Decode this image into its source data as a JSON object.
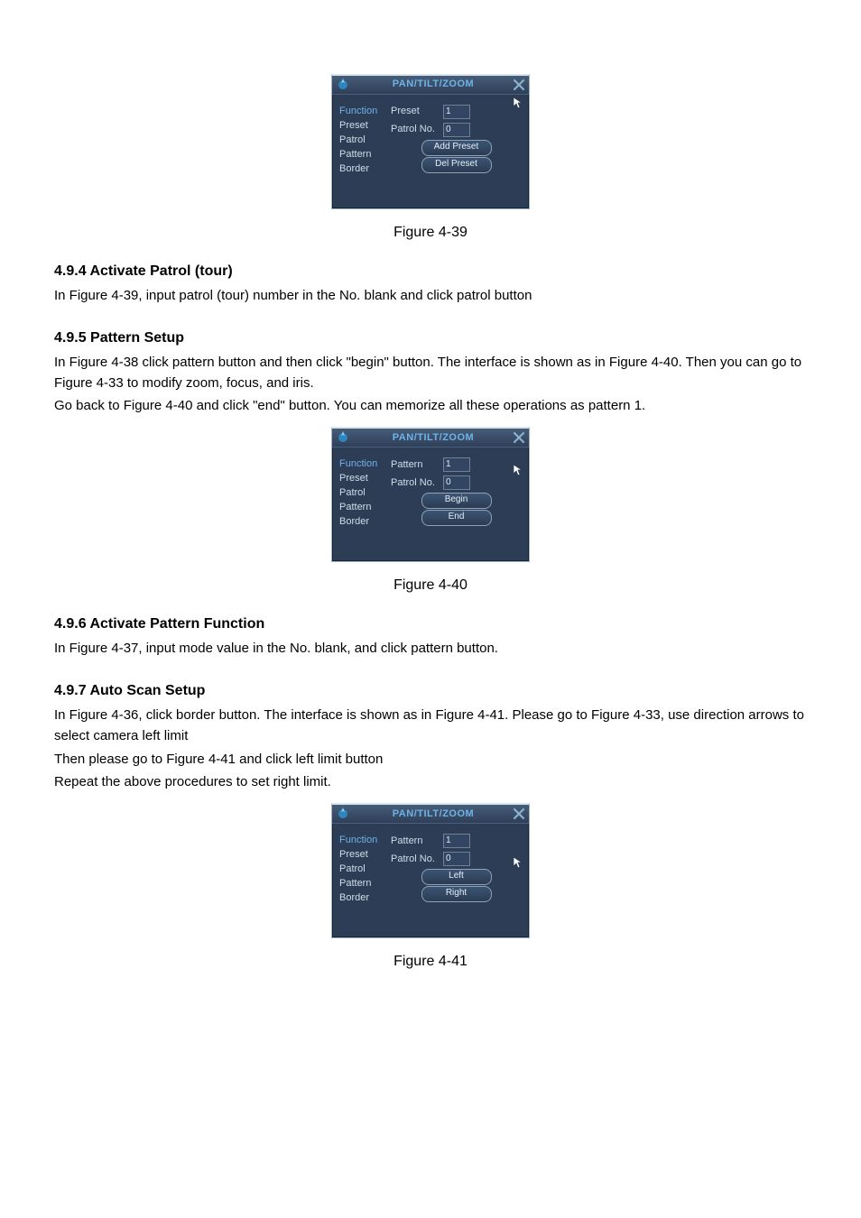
{
  "dialogs": {
    "common": {
      "title": "PAN/TILT/ZOOM",
      "menu": {
        "function": "Function",
        "preset": "Preset",
        "patrol": "Patrol",
        "pattern": "Pattern",
        "border": "Border"
      },
      "field_patrol_no": "Patrol No."
    },
    "d39": {
      "row1_label": "Preset",
      "row1_value": "1",
      "row2_value": "0",
      "btn1": "Add Preset",
      "btn2": "Del Preset"
    },
    "d40": {
      "row1_label": "Pattern",
      "row1_value": "1",
      "row2_value": "0",
      "btn1": "Begin",
      "btn2": "End"
    },
    "d41": {
      "row1_label": "Pattern",
      "row1_value": "1",
      "row2_value": "0",
      "btn1": "Left",
      "btn2": "Right"
    }
  },
  "captions": {
    "fig39": "Figure 4-39",
    "fig40": "Figure 4-40",
    "fig41": "Figure 4-41"
  },
  "sections": {
    "s494": {
      "heading": "4.9.4 Activate Patrol (tour)",
      "p1": "In Figure 4-39, input patrol (tour) number in the No. blank and click patrol button"
    },
    "s495": {
      "heading": "4.9.5 Pattern Setup",
      "p1": "In Figure 4-38 click pattern button and then click \"begin\" button. The interface is shown as in Figure 4-40. Then you can go to Figure 4-33 to modify zoom, focus, and iris.",
      "p2": "Go back to Figure 4-40 and click \"end\" button. You can memorize all these operations as pattern 1."
    },
    "s496": {
      "heading": "4.9.6 Activate Pattern Function",
      "p1": "In Figure 4-37, input mode value in the No. blank, and click pattern button."
    },
    "s497": {
      "heading": "4.9.7 Auto Scan Setup",
      "p1": "In Figure 4-36, click border button. The interface is shown as in Figure 4-41. Please go to Figure 4-33, use direction arrows to select camera left limit",
      "p2": "Then please go to Figure 4-41 and click left limit button",
      "p3": "Repeat the above procedures to set right limit."
    }
  }
}
